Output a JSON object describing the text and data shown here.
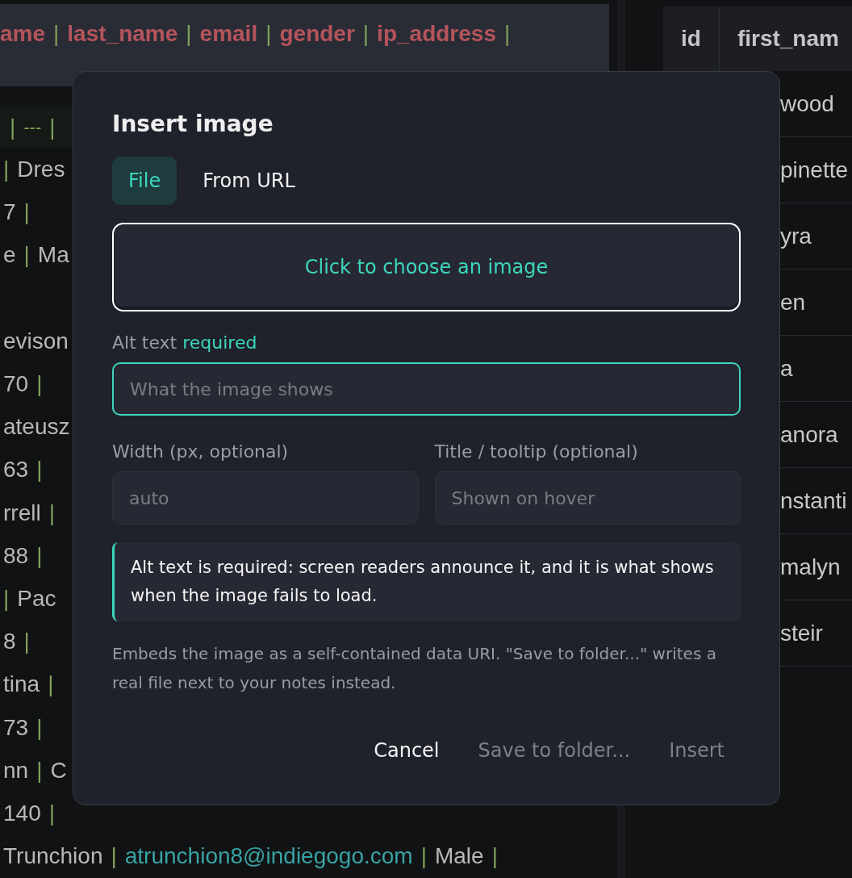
{
  "editor": {
    "lines": [
      {
        "kind": "header",
        "tokens": [
          {
            "kind": "header",
            "text": "ame"
          },
          {
            "kind": "pipe",
            "text": "|"
          },
          {
            "kind": "header",
            "text": "last_name"
          },
          {
            "kind": "pipe",
            "text": "|"
          },
          {
            "kind": "header",
            "text": "email"
          },
          {
            "kind": "pipe",
            "text": "|"
          },
          {
            "kind": "header",
            "text": "gender"
          },
          {
            "kind": "pipe",
            "text": "|"
          },
          {
            "kind": "header",
            "text": "ip_address"
          },
          {
            "kind": "pipe",
            "text": "|"
          }
        ]
      },
      {
        "kind": "rule",
        "tokens": [
          {
            "kind": "pipe",
            "text": "|"
          },
          {
            "kind": "rule",
            "text": "---"
          },
          {
            "kind": "pipe",
            "text": "|"
          }
        ]
      },
      {
        "kind": "row",
        "tokens": [
          {
            "kind": "pipe",
            "text": "|"
          },
          {
            "kind": "text",
            "text": "Dres"
          }
        ]
      },
      {
        "kind": "row",
        "tokens": [
          {
            "kind": "text",
            "text": "7"
          },
          {
            "kind": "pipe",
            "text": "|"
          }
        ]
      },
      {
        "kind": "row",
        "tokens": [
          {
            "kind": "text",
            "text": "e"
          },
          {
            "kind": "pipe",
            "text": "|"
          },
          {
            "kind": "text",
            "text": "Ma"
          }
        ]
      },
      {
        "kind": "row"
      },
      {
        "kind": "row",
        "tokens": [
          {
            "kind": "text",
            "text": "evison"
          }
        ]
      },
      {
        "kind": "row",
        "tokens": [
          {
            "kind": "text",
            "text": "70"
          },
          {
            "kind": "pipe",
            "text": "|"
          }
        ]
      },
      {
        "kind": "row",
        "tokens": [
          {
            "kind": "text",
            "text": "ateusz"
          }
        ]
      },
      {
        "kind": "row",
        "tokens": [
          {
            "kind": "text",
            "text": "63"
          },
          {
            "kind": "pipe",
            "text": "|"
          }
        ]
      },
      {
        "kind": "row",
        "tokens": [
          {
            "kind": "text",
            "text": "rrell"
          },
          {
            "kind": "pipe",
            "text": "|"
          }
        ]
      },
      {
        "kind": "row",
        "tokens": [
          {
            "kind": "text",
            "text": "88"
          },
          {
            "kind": "pipe",
            "text": "|"
          }
        ]
      },
      {
        "kind": "row",
        "tokens": [
          {
            "kind": "pipe",
            "text": "|"
          },
          {
            "kind": "text",
            "text": "Pac"
          }
        ]
      },
      {
        "kind": "row",
        "tokens": [
          {
            "kind": "text",
            "text": "8"
          },
          {
            "kind": "pipe",
            "text": "|"
          }
        ]
      },
      {
        "kind": "row",
        "tokens": [
          {
            "kind": "text",
            "text": "tina"
          },
          {
            "kind": "pipe",
            "text": "|"
          }
        ]
      },
      {
        "kind": "row",
        "tokens": [
          {
            "kind": "text",
            "text": "73"
          },
          {
            "kind": "pipe",
            "text": "|"
          }
        ]
      },
      {
        "kind": "row",
        "tokens": [
          {
            "kind": "text",
            "text": "nn"
          },
          {
            "kind": "pipe",
            "text": "|"
          },
          {
            "kind": "text",
            "text": "C"
          }
        ]
      },
      {
        "kind": "row",
        "tokens": [
          {
            "kind": "text",
            "text": "140"
          },
          {
            "kind": "pipe",
            "text": "|"
          }
        ]
      },
      {
        "kind": "row",
        "tokens": [
          {
            "kind": "text",
            "text": "Trunchion"
          },
          {
            "kind": "pipe",
            "text": "|"
          },
          {
            "kind": "email",
            "text": "atrunchion8@indiegogo.com"
          },
          {
            "kind": "pipe",
            "text": "|"
          },
          {
            "kind": "text",
            "text": "Male"
          },
          {
            "kind": "pipe",
            "text": "|"
          }
        ]
      }
    ]
  },
  "preview": {
    "columns": [
      "id",
      "first_nam"
    ],
    "rows": [
      "wood",
      "pinette",
      "yra",
      "en",
      "a",
      "anora",
      "nstanti",
      "malyn",
      "steir"
    ]
  },
  "dialog": {
    "title": "Insert image",
    "tabs": [
      {
        "label": "File",
        "selected": true
      },
      {
        "label": "From URL",
        "selected": false
      }
    ],
    "dropzone": "Click to choose an image",
    "alt": {
      "label": "Alt text",
      "hint": "required",
      "placeholder": "What the image shows"
    },
    "fields": [
      {
        "label": "Width (px, optional)",
        "placeholder": "auto"
      },
      {
        "label": "Title / tooltip (optional)",
        "placeholder": "Shown on hover"
      }
    ],
    "callout": "Alt text is required: screen readers announce it, and it is what shows when the image fails to load.",
    "note": "Embeds the image as a self-contained data URI. \"Save to folder...\" writes a real file next to your notes instead.",
    "buttons": [
      {
        "label": "Cancel",
        "disabled": false
      },
      {
        "label": "Save to folder...",
        "disabled": true
      },
      {
        "label": "Insert",
        "disabled": true
      }
    ]
  }
}
